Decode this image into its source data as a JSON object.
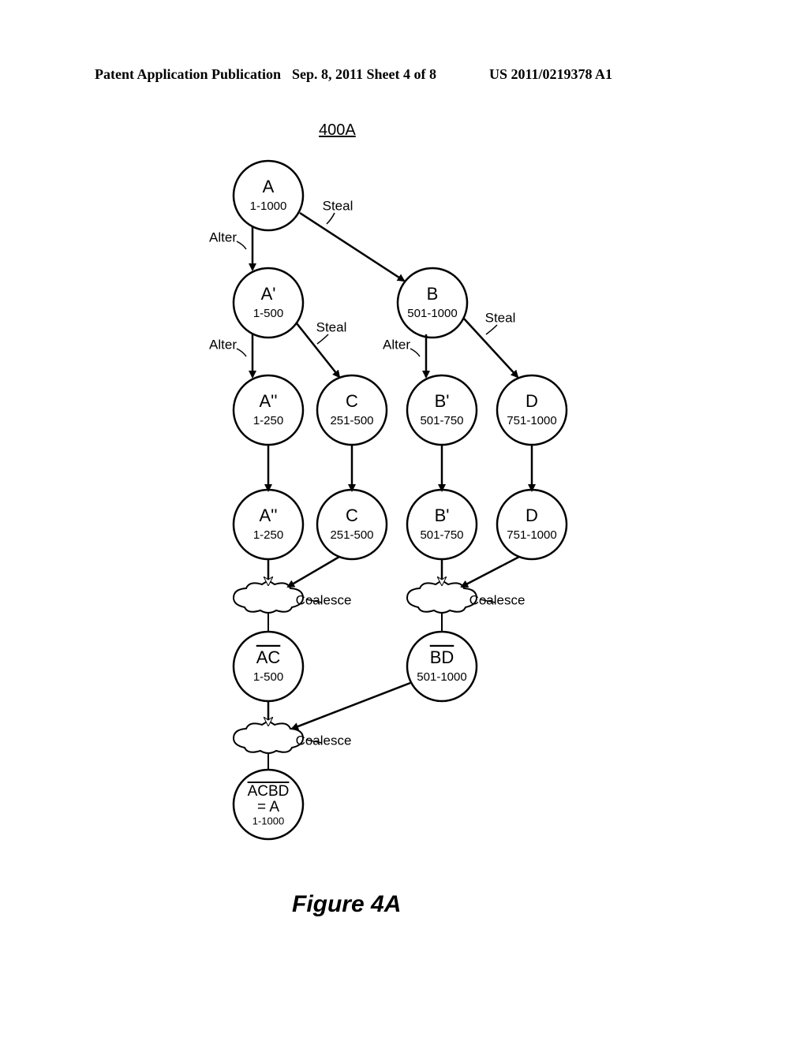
{
  "header": {
    "left": "Patent Application Publication",
    "mid": "Sep. 8, 2011  Sheet 4 of 8",
    "right": "US 2011/0219378 A1"
  },
  "diagram": {
    "ref": "400A",
    "caption": "Figure 4A",
    "nodes": {
      "A": {
        "top": "A",
        "bot": "1-1000"
      },
      "Ap": {
        "top": "A'",
        "bot": "1-500"
      },
      "B": {
        "top": "B",
        "bot": "501-1000"
      },
      "App": {
        "top": "A''",
        "bot": "1-250"
      },
      "C": {
        "top": "C",
        "bot": "251-500"
      },
      "Bp": {
        "top": "B'",
        "bot": "501-750"
      },
      "D": {
        "top": "D",
        "bot": "751-1000"
      },
      "App2": {
        "top": "A''",
        "bot": "1-250"
      },
      "C2": {
        "top": "C",
        "bot": "251-500"
      },
      "Bp2": {
        "top": "B'",
        "bot": "501-750"
      },
      "D2": {
        "top": "D",
        "bot": "751-1000"
      },
      "AC": {
        "top": "AC",
        "bot": "1-500"
      },
      "BD": {
        "top": "BD",
        "bot": "501-1000"
      },
      "ACBD": {
        "top": "ACBD",
        "mid": "= A",
        "bot": "1-1000"
      }
    },
    "labels": {
      "steal": "Steal",
      "alter": "Alter",
      "coalesce": "Coalesce"
    }
  }
}
